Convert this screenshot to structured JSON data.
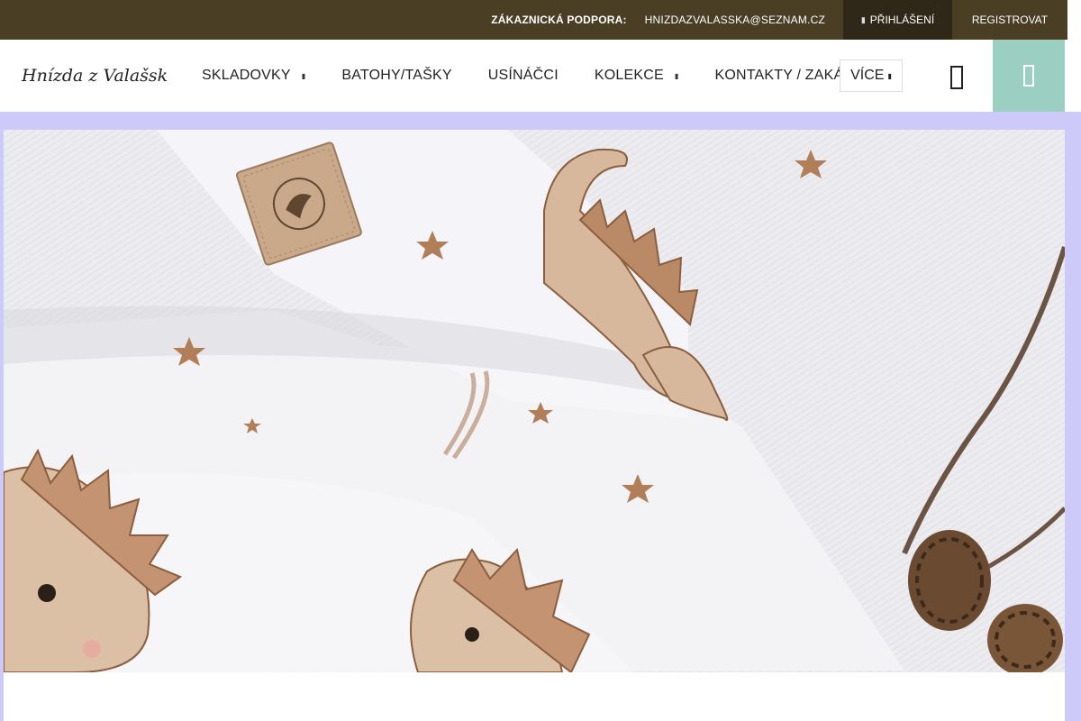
{
  "topbar": {
    "support_label": "ZÁKAZNICKÁ PODPORA:",
    "support_email": "HNIZDAZVALASSKA@SEZNAM.CZ",
    "login_label": "PŘIHLÁŠENÍ",
    "register_label": "REGISTROVAT"
  },
  "header": {
    "logo_text": "Hnízda z Valašska",
    "nav": [
      {
        "label": "SKLADOVKY",
        "has_dropdown": true
      },
      {
        "label": "BATOHY/TAŠKY",
        "has_dropdown": false
      },
      {
        "label": "USÍNÁČCI",
        "has_dropdown": false
      },
      {
        "label": "KOLEKCE",
        "has_dropdown": true
      },
      {
        "label": "KONTAKTY / ZAKÁZKY",
        "has_dropdown": false
      }
    ],
    "more_label": "VÍCE"
  },
  "colors": {
    "topbar_bg": "#4a3e25",
    "login_bg": "#2f2818",
    "cart_bg": "#9bcfc2",
    "page_bg": "#cdc9f9"
  },
  "icons": {
    "search": "search-icon",
    "cart": "cart-icon",
    "login": "user-icon",
    "caret": "chevron-down-icon"
  }
}
